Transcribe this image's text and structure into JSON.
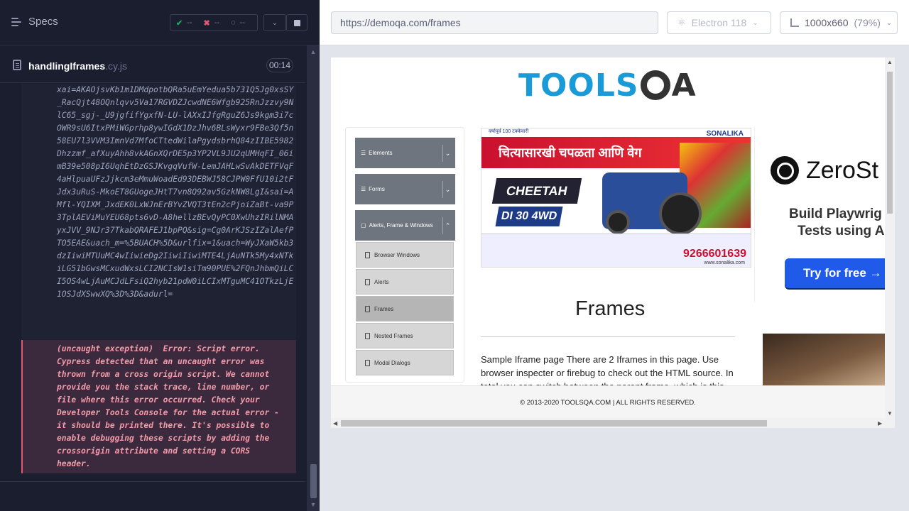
{
  "sidebar": {
    "title": "Specs",
    "stats": {
      "passed": "--",
      "failed": "--",
      "pending": "--"
    },
    "file": {
      "name": "handlingIframes",
      "ext": ".cy.js",
      "duration": "00:14"
    },
    "log_url": "xai=AKAOjsvKb1m1DMdpotbQRa5uEmYedua5b731Q5Jg0xsSY_RacQjt48OQnlqvv5Va17RGVDZJcwdNE6Wfgb925RnJzzvy9NlC65_sgj-_U9jgfifYgxfN-LU-lAXxIJfgRguZ6Js9kgm3i7cOWR9sU6ItxPMiWGprhp8ywIGdX1DzJhv6BLsWyxr9FBe3Qf5n58EU7l3VVM3ImnVd7MfoCTtedWilaPgydsbrhQ84zIIBE5982Dhzzmf_afXuyAhh8vkAGnXQrDE5p3YP2VL9JU2qUMHqFI_06imB39e508pI6UqhEtDzGSJKvgqVufW-LemJAHLwSvAkDETFVqF4aHlpuaUFzJjkcm3eMmuWoadEd93DEBWJ58CJPW0FfU10i2tFJdx3uRuS-MkoET8GUogeJHtT7vn8Q92av5GzkNW8LgI&sai=AMfl-YQIXM_JxdEK0LxWJnErBYvZVQT3tEn2cPjoiZaBt-va9P3TplAEViMuYEU68pts6vD-A8hellzBEvQyPC0XwUhzIRilNMAyxJVV_9NJr37TkabQRAFEJ1bpPQ&sig=Cg0ArKJSzIZalAefPTO5EAE&uach_m=%5BUACH%5D&urlfix=1&uach=WyJXaW5kb3dzIiwiMTUuMC4wIiwieDg2IiwiIiwiMTE4LjAuNTk5My4xNTkiLG51bGwsMCxudWxsLCI2NCIsW1siTm90PUE%2FQnJhbmQiLCI5OS4wLjAuMCJdLFsiQ2hyb21pdW0iLCIxMTguMC41OTkzLjE1OSJdXSwwXQ%3D%3D&adurl=",
    "error": "(uncaught exception)  Error: Script error.\nCypress detected that an uncaught error was\nthrown from a cross origin script. We cannot\nprovide you the stack trace, line number, or\nfile where this error occurred. Check your\nDeveloper Tools Console for the actual error -\nit should be printed there. It's possible to\nenable debugging these scripts by adding the\ncrossorigin attribute and setting a CORS\nheader."
  },
  "browser": {
    "url": "https://demoqa.com/frames",
    "engine": "Electron 118",
    "viewport": "1000x660",
    "zoom": "(79%)"
  },
  "page": {
    "logo_left": "TOOLS",
    "logo_right": "A",
    "nav": {
      "groups": [
        "Elements",
        "Forms",
        "Alerts, Frame & Windows"
      ],
      "items": [
        "Browser Windows",
        "Alerts",
        "Frames",
        "Nested Frames",
        "Modal Dialogs"
      ]
    },
    "ad": {
      "top": "वर्षापूर्व 100 टक्केवारी",
      "brand": "SONALIKA",
      "headline": "चित्यासारखी चपळता आणि वेग",
      "model": "CHEETAH",
      "engine": "DI 30 4WD",
      "phone": "9266601639",
      "site": "www.sonalika.com"
    },
    "side_ad": {
      "brand": "ZeroSt",
      "line1": "Build Playwrig",
      "line2": "Tests using A",
      "cta": "Try for free →"
    },
    "title": "Frames",
    "description": "Sample Iframe page There are 2 Iframes in this page. Use browser inspecter or firebug to check out the HTML source. In total you can switch between the parent frame, which is this",
    "footer": "© 2013-2020 TOOLSQA.COM | ALL RIGHTS RESERVED."
  }
}
